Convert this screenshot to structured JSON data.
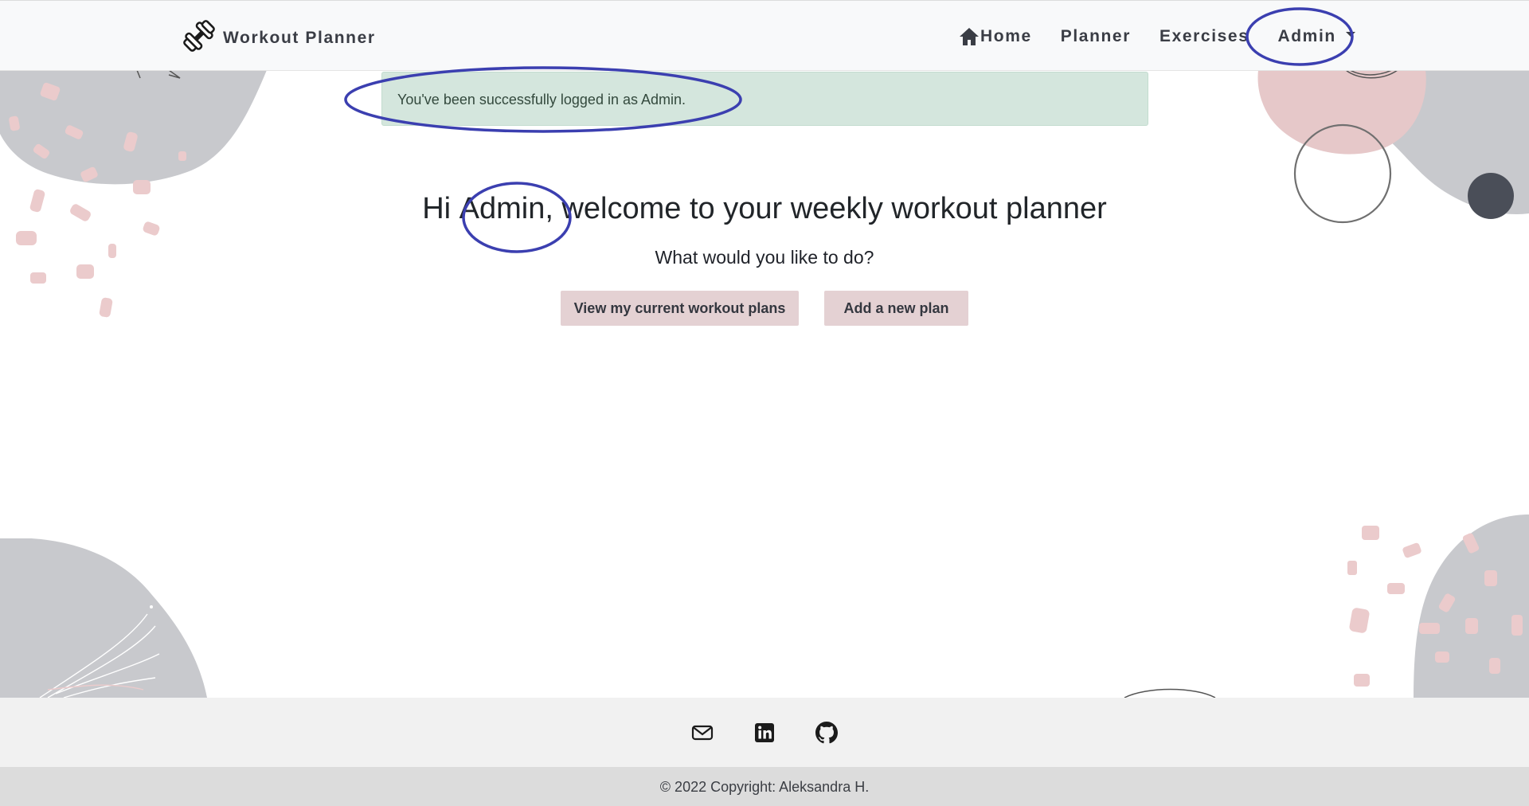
{
  "brand": {
    "name": "Workout Planner",
    "icon": "dumbbell-icon"
  },
  "nav": {
    "home": "Home",
    "planner": "Planner",
    "exercises": "Exercises",
    "user_menu": "Admin"
  },
  "alert": {
    "message": "You've been successfully logged in as Admin."
  },
  "main": {
    "greeting_prefix": "Hi ",
    "username": "Admin,",
    "greeting_suffix": " welcome to your weekly workout planner",
    "subtitle": "What would you like to do?",
    "view_button": "View my current workout plans",
    "add_button": "Add a new plan"
  },
  "footer": {
    "icons": [
      "envelope-icon",
      "linkedin-icon",
      "github-icon"
    ],
    "copyright": "© 2022 Copyright: Aleksandra H."
  },
  "colors": {
    "annotation": "#3b3fb0",
    "button_bg": "#e4d1d3",
    "alert_bg": "#d4e6dd",
    "deco_gray": "#c8c9cd",
    "deco_pink": "#ebcbcc"
  }
}
